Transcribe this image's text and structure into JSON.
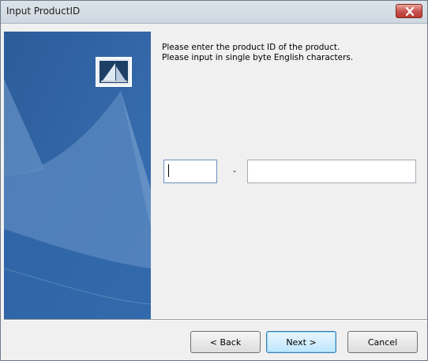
{
  "window": {
    "title": "Input ProductID"
  },
  "instructions": {
    "line1": "Please enter the product ID of the product.",
    "line2": "Please input in single byte English characters."
  },
  "product_id": {
    "part1_value": "",
    "separator": "-",
    "part2_value": ""
  },
  "buttons": {
    "back": "< Back",
    "next": "Next >",
    "cancel": "Cancel"
  },
  "colors": {
    "banner_blue": "#2e63a3",
    "close_red": "#c75050"
  },
  "icons": {
    "close": "close-icon",
    "logo": "sail-logo-icon"
  }
}
